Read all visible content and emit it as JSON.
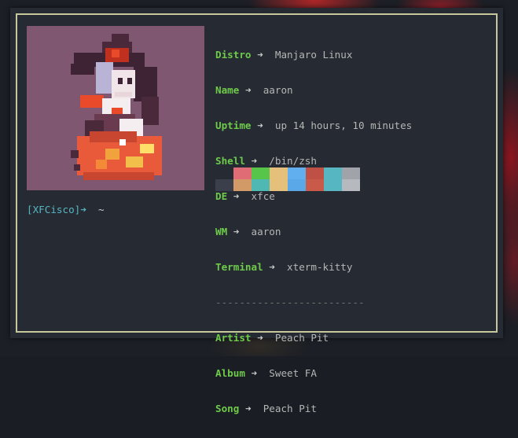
{
  "info": [
    {
      "key": "Distro",
      "arrow": "➜",
      "value": "Manjaro Linux"
    },
    {
      "key": "Name",
      "arrow": "➜",
      "value": "aaron"
    },
    {
      "key": "Uptime",
      "arrow": "➜",
      "value": "up 14 hours, 10 minutes"
    },
    {
      "key": "Shell",
      "arrow": "➜",
      "value": "/bin/zsh"
    },
    {
      "key": "DE",
      "arrow": "➜",
      "value": "xfce"
    },
    {
      "key": "WM",
      "arrow": "➜",
      "value": "aaron"
    },
    {
      "key": "Terminal",
      "arrow": "➜",
      "value": "xterm-kitty"
    }
  ],
  "separator": "-------------------------",
  "music": [
    {
      "key": "Artist",
      "arrow": "➜",
      "value": "Peach Pit"
    },
    {
      "key": "Album",
      "arrow": "➜",
      "value": "Sweet FA"
    },
    {
      "key": "Song",
      "arrow": "➜",
      "value": "Peach Pit"
    }
  ],
  "palette": {
    "row1": [
      "#262a33",
      "#e06c75",
      "#56c54a",
      "#e5c07b",
      "#61afef",
      "#be5046",
      "#56b6c2",
      "#a0a4aa"
    ],
    "row2": [
      "#3a3f4b",
      "#d19a66",
      "#4fb8b2",
      "#e5c07b",
      "#5aa8e8",
      "#c95a4a",
      "#56b6c2",
      "#b6b9be"
    ]
  },
  "prompt": {
    "host": "[XFCisco]",
    "arrow": "➜",
    "cwd": "~"
  },
  "colors": {
    "key": "#6ecb4a",
    "text": "#b4b7b4",
    "prompt": "#56b6c2",
    "border": "#c6c79a",
    "art_bg": "#7f5771"
  }
}
